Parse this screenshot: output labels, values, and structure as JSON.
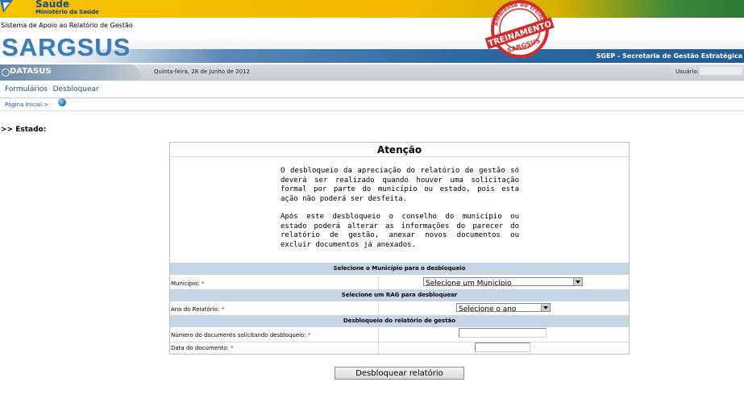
{
  "header": {
    "brand_top": "Saúde",
    "ministry": "Ministério da Saúde",
    "system_name": "Sistema de Apoio ao Relatório de Gestão",
    "app_title": "SARGSUS",
    "secretariat": "SGEP - Secretaria de Gestão Estratégica",
    "stamp_arc": "Ambiente de treinamento",
    "stamp_label": "TREINAMENTO",
    "stamp_sub": "SARGSUS"
  },
  "topbar": {
    "datasus": "DATASUS",
    "date": "Quinta-feira, 28 de Junho de 2012",
    "user_label": "Usuário:"
  },
  "menu": {
    "items": [
      "Formulários",
      "Desbloquear"
    ]
  },
  "breadcrumb": {
    "home": "Página Inicial >"
  },
  "page": {
    "heading": ">> Estado:"
  },
  "panel": {
    "title": "Atenção",
    "paragraph1": "O desbloqueio da apreciação do relatório de gestão só deverá ser realizado quando houver uma solicitação formal por parte do município ou estado, pois esta ação não poderá ser desfeita.",
    "paragraph2": "Após este desbloqueio o conselho do município ou estado poderá alterar as informações do parecer do relatório de gestão, anexar novos documentos ou excluir documentos já anexados.",
    "section_municipio": "Selecione o Município para o desbloqueio",
    "label_municipio": "Município:",
    "select_municipio": "Selecione um Município",
    "section_rag": "Selecione um RAG para desbloquear",
    "label_ano": "Ano do Relatório:",
    "select_ano": "Selecione o ano",
    "section_desbloqueio": "Desbloqueio do relatório de gestão",
    "label_numero": "Número do documento solicitando desbloqueio:",
    "label_data": "Data do documento:",
    "required_mark": "*"
  },
  "actions": {
    "unlock_button": "Desbloquear relatório"
  },
  "colors": {
    "header_yellow": "#f2b800",
    "title_blue": "#3e7ab5",
    "section_bg": "#c6d5e6",
    "link_blue": "#1a4f8f",
    "required": "#dd0000"
  }
}
